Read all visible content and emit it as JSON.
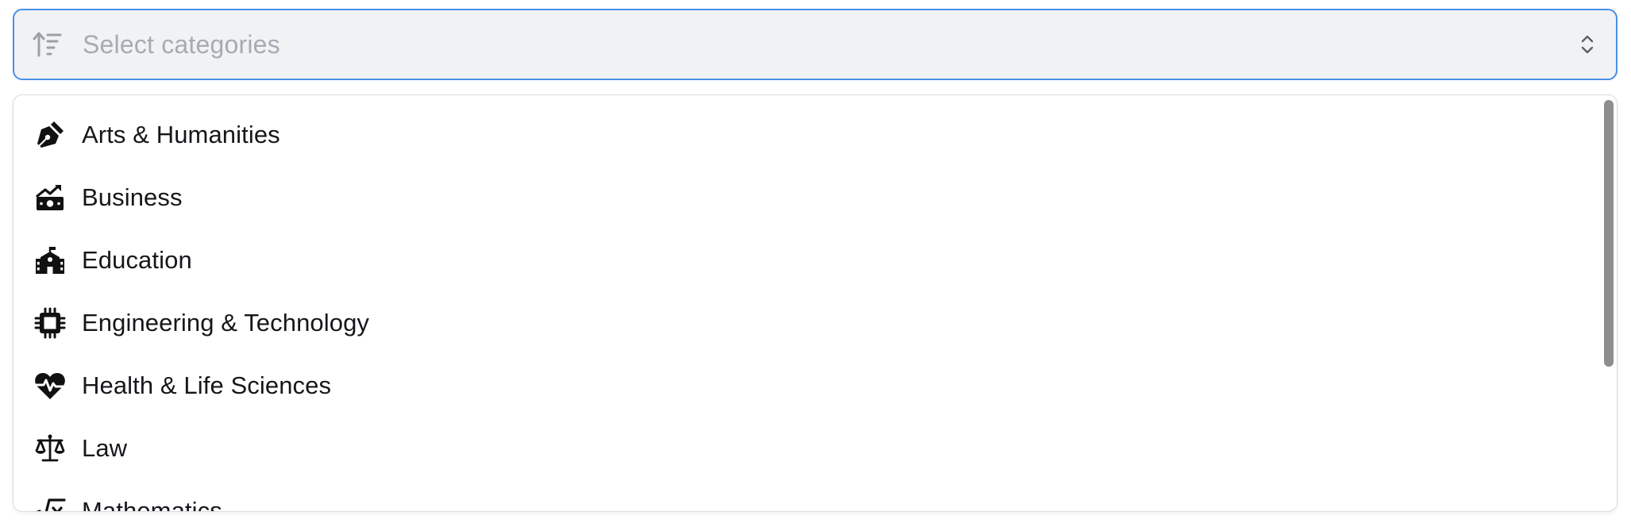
{
  "select": {
    "placeholder": "Select categories",
    "leading_icon": "sort-ascending-icon",
    "trailing_icon": "chevrons-up-down-icon",
    "focus_color": "#4a8fe7"
  },
  "options": [
    {
      "label": "Arts & Humanities",
      "icon": "pen-nib-icon"
    },
    {
      "label": "Business",
      "icon": "money-chart-icon"
    },
    {
      "label": "Education",
      "icon": "school-icon"
    },
    {
      "label": "Engineering & Technology",
      "icon": "microchip-icon"
    },
    {
      "label": "Health & Life Sciences",
      "icon": "heart-pulse-icon"
    },
    {
      "label": "Law",
      "icon": "scale-balance-icon"
    },
    {
      "label": "Mathematics",
      "icon": "square-root-icon"
    }
  ]
}
